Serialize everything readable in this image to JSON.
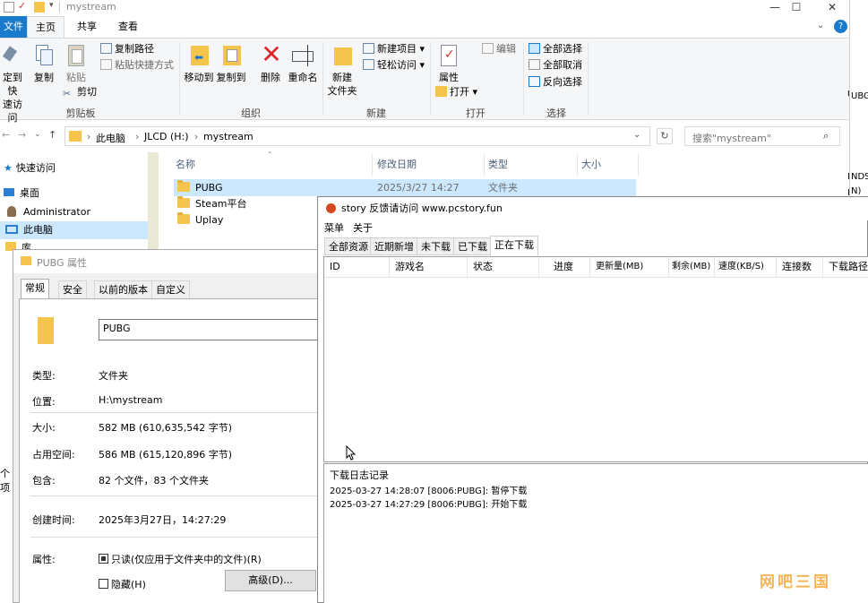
{
  "explorer": {
    "title": "mystream",
    "window_controls": [
      "—",
      "☐",
      "✕"
    ],
    "tabs": [
      "文件",
      "主页",
      "共享",
      "查看"
    ],
    "ribbon": {
      "clipboard": {
        "pin_label_1": "定到快",
        "pin_label_2": "速访问",
        "copy": "复制",
        "paste": "粘贴",
        "copy_path": "复制路径",
        "paste_shortcut": "粘贴快捷方式",
        "cut": "剪切",
        "group": "剪贴板"
      },
      "organize": {
        "move_to": "移动到",
        "copy_to": "复制到",
        "delete": "删除",
        "rename": "重命名",
        "group": "组织"
      },
      "new": {
        "new_folder_1": "新建",
        "new_folder_2": "文件夹",
        "new_item": "新建项目",
        "easy_access": "轻松访问",
        "group": "新建"
      },
      "open": {
        "properties": "属性",
        "open": "打开",
        "edit": "编辑",
        "group": "打开"
      },
      "select": {
        "select_all": "全部选择",
        "select_none": "全部取消",
        "invert": "反向选择",
        "group": "选择"
      }
    },
    "breadcrumb": [
      "此电脑",
      "JLCD (H:)",
      "mystream"
    ],
    "search_placeholder": "搜索\"mystream\"",
    "nav": [
      "快速访问",
      "桌面",
      "Administrator",
      "此电脑",
      "库"
    ],
    "columns": [
      "名称",
      "修改日期",
      "类型",
      "大小"
    ],
    "files": [
      {
        "name": "PUBG",
        "date": "2025/3/27 14:27",
        "type": "文件夹"
      },
      {
        "name": "Steam平台",
        "date": "",
        "type": ""
      },
      {
        "name": "Uplay",
        "date": "",
        "type": ""
      }
    ],
    "status_fragment": "个项",
    "right_edge_fragments": [
      "UBG",
      "NDS",
      "N)"
    ]
  },
  "props": {
    "title": "PUBG 属性",
    "tabs": [
      "常规",
      "安全",
      "以前的版本",
      "自定义"
    ],
    "name_value": "PUBG",
    "rows": [
      {
        "label": "类型:",
        "value": "文件夹"
      },
      {
        "label": "位置:",
        "value": "H:\\mystream"
      },
      {
        "label": "大小:",
        "value": "582 MB (610,635,542 字节)"
      },
      {
        "label": "占用空间:",
        "value": "586 MB (615,120,896 字节)"
      },
      {
        "label": "包含:",
        "value": "82 个文件，83 个文件夹"
      },
      {
        "label": "创建时间:",
        "value": "2025年3月27日，14:27:29"
      }
    ],
    "attr_label": "属性:",
    "readonly": "只读(仅应用于文件夹中的文件)(R)",
    "hidden": "隐藏(H)",
    "advanced": "高级(D)..."
  },
  "story": {
    "title": "story 反馈请访问 www.pcstory.fun",
    "menu": [
      "菜单",
      "关于"
    ],
    "tabs": [
      "全部资源",
      "近期新增",
      "未下载",
      "已下载",
      "正在下载"
    ],
    "columns": [
      "ID",
      "游戏名",
      "状态",
      "进度",
      "更新量(MB)",
      "剩余(MB)",
      "速度(KB/S)",
      "连接数",
      "下载路径"
    ],
    "log_title": "下载日志记录",
    "log": [
      "2025-03-27 14:28:07  [8006:PUBG]: 暂停下载",
      "2025-03-27 14:27:29  [8006:PUBG]: 开始下载"
    ]
  },
  "watermark": "网吧三国",
  "colors": {
    "accent": "#1979ca",
    "selection": "#cce8ff",
    "delete_red": "#d9262c"
  }
}
